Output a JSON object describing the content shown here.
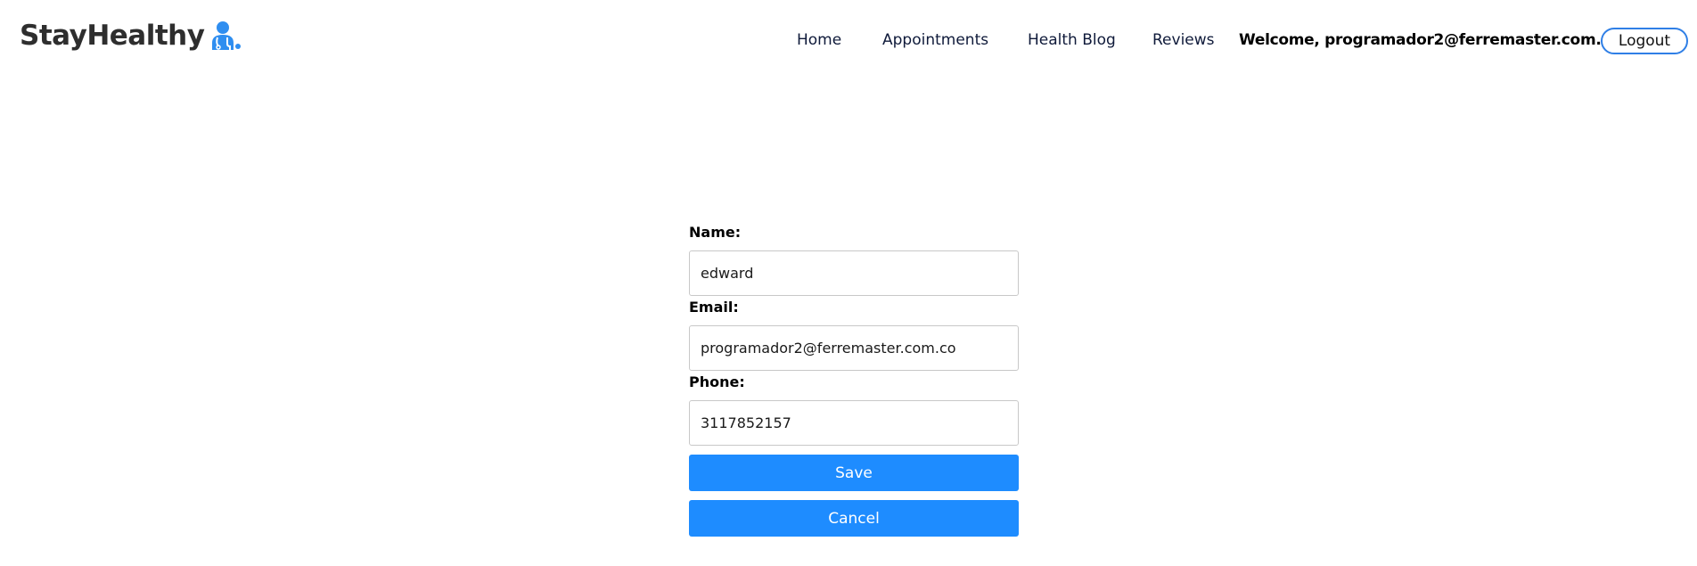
{
  "brand": {
    "name": "StayHealthy",
    "icon": "doctor-icon",
    "accent": "#2f8ef0"
  },
  "nav": {
    "links": [
      {
        "label": "Home"
      },
      {
        "label": "Appointments"
      },
      {
        "label": "Health Blog"
      },
      {
        "label": "Reviews"
      }
    ],
    "welcome": "Welcome, programador2@ferremaster.com.co",
    "logout_label": "Logout"
  },
  "form": {
    "name_label": "Name:",
    "name_value": "edward",
    "email_label": "Email:",
    "email_value": "programador2@ferremaster.com.co",
    "phone_label": "Phone:",
    "phone_value": "3117852157",
    "save_label": "Save",
    "cancel_label": "Cancel"
  },
  "colors": {
    "primary_button": "#1e8cff",
    "logout_border": "#2f7fe6"
  }
}
